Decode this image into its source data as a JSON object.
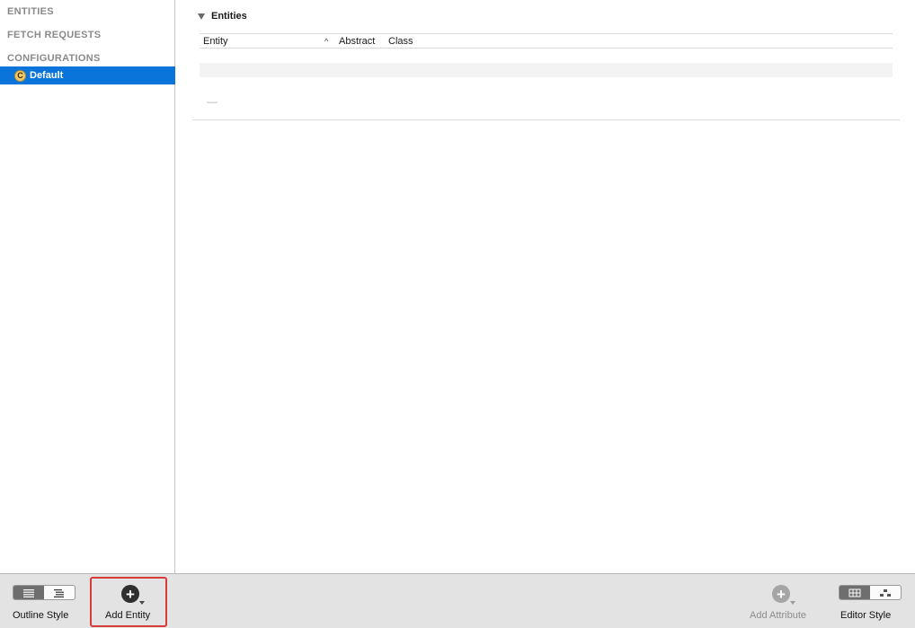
{
  "sidebar": {
    "sections": {
      "entities": "ENTITIES",
      "fetch_requests": "FETCH REQUESTS",
      "configurations": "CONFIGURATIONS"
    },
    "selected_item": {
      "icon_letter": "C",
      "label": "Default"
    }
  },
  "editor": {
    "section_title": "Entities",
    "table": {
      "columns": [
        "Entity",
        "Abstract",
        "Class"
      ],
      "sort_indicator": "^",
      "rows": []
    },
    "remove_mark": "—"
  },
  "toolbar": {
    "outline_style_label": "Outline Style",
    "add_entity_label": "Add Entity",
    "add_attribute_label": "Add Attribute",
    "editor_style_label": "Editor Style",
    "add_glyph": "+"
  },
  "colors": {
    "selection": "#0a74da",
    "highlight_box": "#d93b3b",
    "toolbar_bg": "#e3e3e3"
  }
}
